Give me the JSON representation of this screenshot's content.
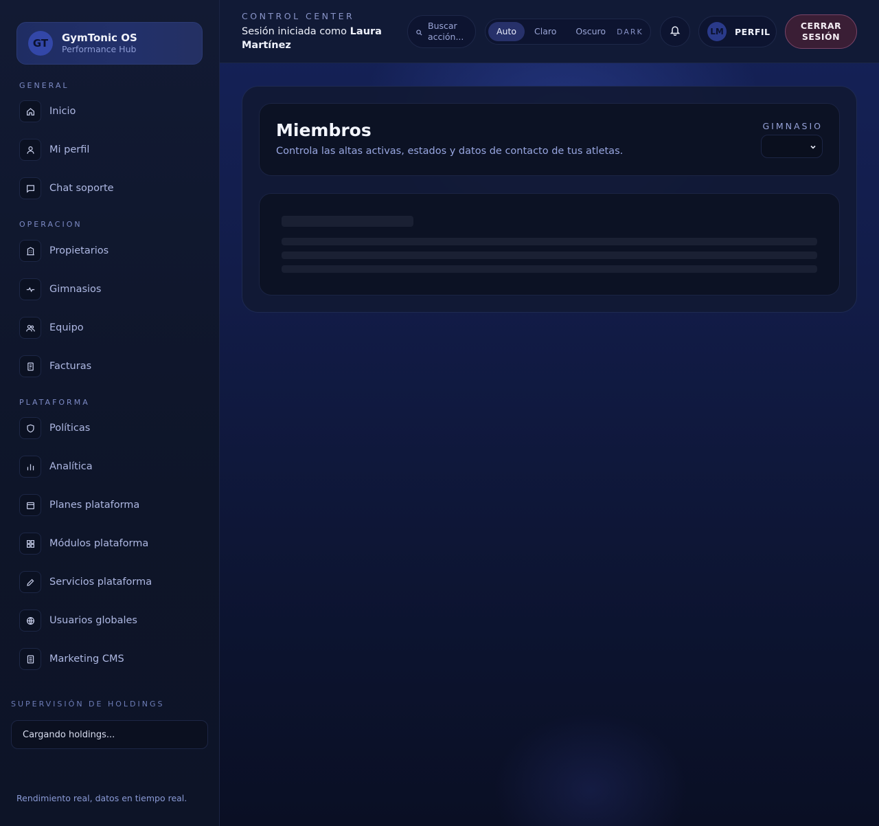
{
  "brand": {
    "initials": "GT",
    "name": "GymTonic OS",
    "subtitle": "Performance Hub"
  },
  "nav": {
    "sections": [
      {
        "title": "General",
        "items": [
          {
            "label": "Inicio",
            "icon": "home-icon"
          },
          {
            "label": "Mi perfil",
            "icon": "user-icon"
          },
          {
            "label": "Chat soporte",
            "icon": "chat-icon"
          }
        ]
      },
      {
        "title": "Operacion",
        "items": [
          {
            "label": "Propietarios",
            "icon": "building-icon"
          },
          {
            "label": "Gimnasios",
            "icon": "pulse-icon"
          },
          {
            "label": "Equipo",
            "icon": "team-icon"
          },
          {
            "label": "Facturas",
            "icon": "receipt-icon"
          }
        ]
      },
      {
        "title": "Plataforma",
        "items": [
          {
            "label": "Políticas",
            "icon": "shield-icon"
          },
          {
            "label": "Analítica",
            "icon": "bar-chart-icon"
          },
          {
            "label": "Planes plataforma",
            "icon": "calendar-icon"
          },
          {
            "label": "Módulos plataforma",
            "icon": "modules-icon"
          },
          {
            "label": "Servicios plataforma",
            "icon": "pencil-icon"
          },
          {
            "label": "Usuarios globales",
            "icon": "globe-icon"
          },
          {
            "label": "Marketing CMS",
            "icon": "document-icon"
          }
        ]
      }
    ]
  },
  "holdings": {
    "title": "Supervisión de holdings",
    "loading_text": "Cargando holdings..."
  },
  "footer": {
    "text": "Rendimiento real, datos en tiempo real."
  },
  "topbar": {
    "eyebrow": "CONTROL CENTER",
    "session_prefix": "Sesión iniciada como",
    "session_user": "Laura Martínez",
    "search_placeholder": "Buscar acción...",
    "theme_options": [
      "Auto",
      "Claro",
      "Oscuro"
    ],
    "theme_active": "Auto",
    "theme_tag": "DARK",
    "profile_initials": "LM",
    "profile_label": "PERFIL",
    "logout_label": "CERRAR SESIÓN"
  },
  "page": {
    "title": "Miembros",
    "subtitle": "Controla las altas activas, estados y datos de contacto de tus atletas.",
    "gym_filter_label": "GIMNASIO",
    "gym_filter_value": ""
  },
  "colors": {
    "accent": "#27316a",
    "logout_bg": "#3a1e35",
    "logout_border": "#7a4568"
  }
}
